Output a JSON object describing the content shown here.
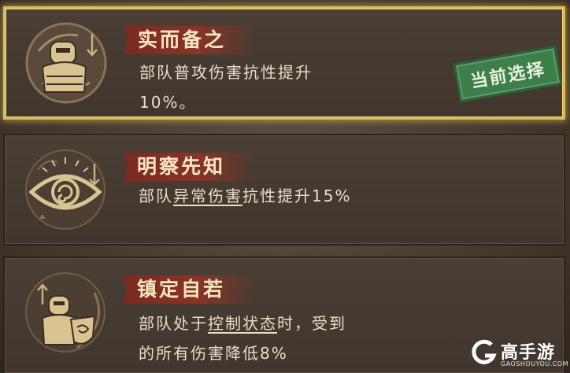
{
  "skills": [
    {
      "title": "实而备之",
      "desc_parts": [
        "部队普攻伤害抗性提升",
        "10%。"
      ],
      "selected": true,
      "badge": "当前选择",
      "icon": "armored-soldier-icon"
    },
    {
      "title": "明察先知",
      "desc_parts": [
        "部队",
        "异常伤害",
        "抗性提升15%"
      ],
      "selected": false,
      "icon": "eye-icon"
    },
    {
      "title": "镇定自若",
      "desc_parts": [
        "部队处于",
        "控制状态",
        "时，受到",
        "的所有伤害降低8%"
      ],
      "selected": false,
      "icon": "shield-soldier-icon"
    }
  ],
  "watermark": {
    "name": "高手游",
    "url": "GAOSHOUYOU.COM",
    "icon": "g-logo-icon"
  },
  "colors": {
    "gold": "#d9bb57",
    "title_ribbon": "#8a3326",
    "stamp_green": "#3d7e4a"
  }
}
